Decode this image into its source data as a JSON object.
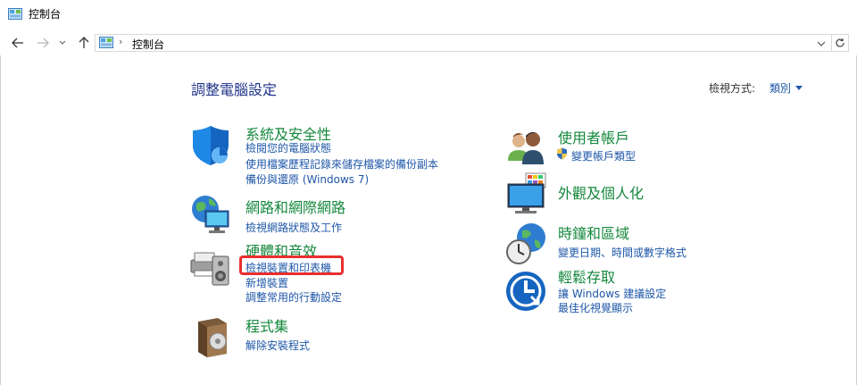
{
  "window": {
    "title": "控制台"
  },
  "address": {
    "path": "控制台"
  },
  "header": {
    "title": "調整電腦設定",
    "view_by_label": "檢視方式:",
    "view_by_value": "類別"
  },
  "categories": {
    "system": {
      "title": "系統及安全性",
      "links": [
        "檢閱您的電腦狀態",
        "使用檔案歷程記錄來儲存檔案的備份副本",
        "備份與還原 (Windows 7)"
      ]
    },
    "network": {
      "title": "網路和網際網路",
      "links": [
        "檢視網路狀態及工作"
      ]
    },
    "hardware": {
      "title": "硬體和音效",
      "links": [
        "檢視裝置和印表機",
        "新增裝置",
        "調整常用的行動設定"
      ]
    },
    "programs": {
      "title": "程式集",
      "links": [
        "解除安裝程式"
      ]
    },
    "users": {
      "title": "使用者帳戶",
      "links": [
        "變更帳戶類型"
      ]
    },
    "appearance": {
      "title": "外觀及個人化",
      "links": []
    },
    "clock": {
      "title": "時鐘和區域",
      "links": [
        "變更日期、時間或數字格式"
      ]
    },
    "ease": {
      "title": "輕鬆存取",
      "links": [
        "讓 Windows 建議設定",
        "最佳化視覺顯示"
      ]
    }
  },
  "colors": {
    "category_title": "#15883d",
    "link": "#1e57a8",
    "page_title": "#1e3287",
    "highlight": "#e8302f"
  }
}
